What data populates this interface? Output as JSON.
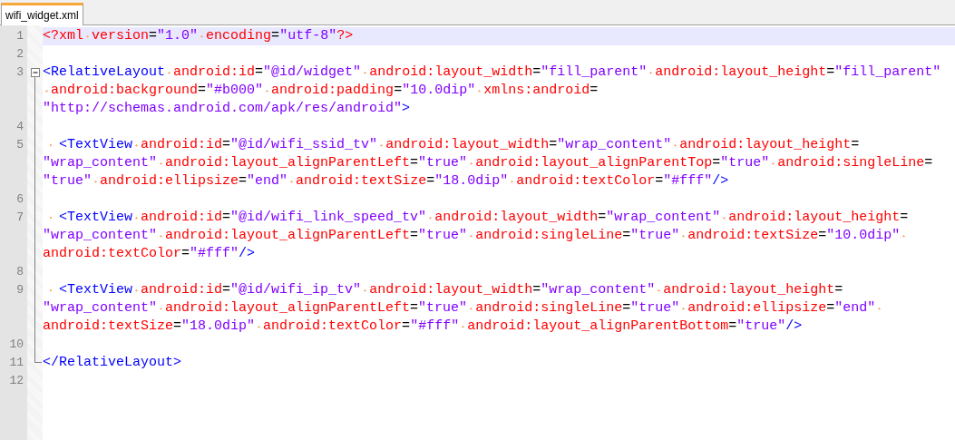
{
  "tabs": [
    {
      "label": "wifi_widget.xml",
      "selected": true
    }
  ],
  "lines": [
    {
      "number": "1",
      "current": true,
      "rows": [
        "<?xml version=\"1.0\" encoding=\"utf-8\"?>"
      ]
    },
    {
      "number": "2",
      "current": false,
      "rows": [
        ""
      ]
    },
    {
      "number": "3",
      "current": false,
      "expanded": true,
      "rows": [
        "<RelativeLayout android:id=\"@id/widget\" android:layout_width=\"fill_parent\" android:layout_height=\"fill_parent\"",
        " android:background=\"#b000\" android:padding=\"10.0dip\" xmlns:android=",
        "\"http://schemas.android.com/apk/res/android\">"
      ],
      "children": [
        {
          "number": "4",
          "current": false,
          "rows": [
            ""
          ]
        },
        {
          "number": "5",
          "current": false,
          "rows": [
            "  <TextView android:id=\"@id/wifi_ssid_tv\" android:layout_width=\"wrap_content\" android:layout_height=",
            "\"wrap_content\" android:layout_alignParentLeft=\"true\" android:layout_alignParentTop=\"true\" android:singleLine=",
            "\"true\" android:ellipsize=\"end\" android:textSize=\"18.0dip\" android:textColor=\"#fff\"/>"
          ]
        },
        {
          "number": "6",
          "current": false,
          "rows": [
            ""
          ]
        },
        {
          "number": "7",
          "current": false,
          "rows": [
            "  <TextView android:id=\"@id/wifi_link_speed_tv\" android:layout_width=\"wrap_content\" android:layout_height=",
            "\"wrap_content\" android:layout_alignParentLeft=\"true\" android:singleLine=\"true\" android:textSize=\"10.0dip\" ",
            "android:textColor=\"#fff\"/>"
          ]
        },
        {
          "number": "8",
          "current": false,
          "rows": [
            ""
          ]
        },
        {
          "number": "9",
          "current": false,
          "rows": [
            "  <TextView android:id=\"@id/wifi_ip_tv\" android:layout_width=\"wrap_content\" android:layout_height=",
            "\"wrap_content\" android:layout_alignParentLeft=\"true\" android:singleLine=\"true\" android:ellipsize=\"end\" ",
            "android:textSize=\"18.0dip\" android:textColor=\"#fff\" android:layout_alignParentBottom=\"true\"/>"
          ]
        },
        {
          "number": "10",
          "current": false,
          "rows": [
            ""
          ]
        },
        {
          "number": "11",
          "current": false,
          "rows": [
            "</RelativeLayout>"
          ]
        }
      ]
    },
    {
      "number": "12",
      "current": false,
      "rows": [
        ""
      ]
    }
  ]
}
